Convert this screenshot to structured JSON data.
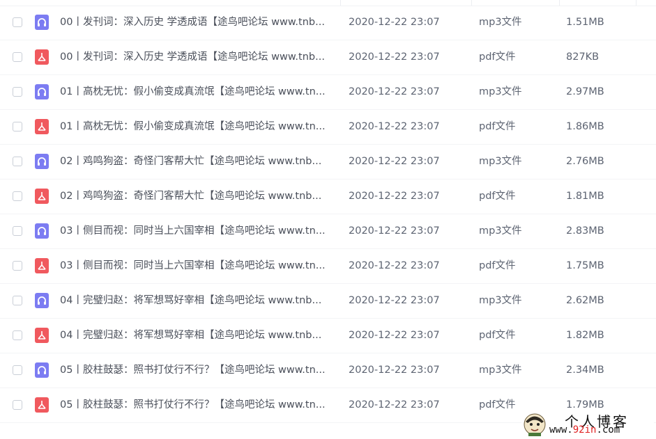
{
  "colors": {
    "mp3_icon": "#7c7cf2",
    "pdf_icon": "#f0595e",
    "text": "#4a4f5a",
    "watermark_accent": "#e02020"
  },
  "files": [
    {
      "icon": "headphones-icon",
      "kind": "mp3",
      "name": "00丨发刊词：深入历史 学透成语【途鸟吧论坛 www.tnb...",
      "date": "2020-12-22 23:07",
      "type": "mp3文件",
      "size": "1.51MB"
    },
    {
      "icon": "pdf-icon",
      "kind": "pdf",
      "name": "00丨发刊词：深入历史 学透成语【途鸟吧论坛 www.tnb...",
      "date": "2020-12-22 23:07",
      "type": "pdf文件",
      "size": "827KB"
    },
    {
      "icon": "headphones-icon",
      "kind": "mp3",
      "name": "01丨高枕无忧：假小偷变成真流氓【途鸟吧论坛 www.tn...",
      "date": "2020-12-22 23:07",
      "type": "mp3文件",
      "size": "2.97MB"
    },
    {
      "icon": "pdf-icon",
      "kind": "pdf",
      "name": "01丨高枕无忧：假小偷变成真流氓【途鸟吧论坛 www.tn...",
      "date": "2020-12-22 23:07",
      "type": "pdf文件",
      "size": "1.86MB"
    },
    {
      "icon": "headphones-icon",
      "kind": "mp3",
      "name": "02丨鸡鸣狗盗：奇怪门客帮大忙【途鸟吧论坛 www.tnb...",
      "date": "2020-12-22 23:07",
      "type": "mp3文件",
      "size": "2.76MB"
    },
    {
      "icon": "pdf-icon",
      "kind": "pdf",
      "name": "02丨鸡鸣狗盗：奇怪门客帮大忙【途鸟吧论坛 www.tnb...",
      "date": "2020-12-22 23:07",
      "type": "pdf文件",
      "size": "1.81MB"
    },
    {
      "icon": "headphones-icon",
      "kind": "mp3",
      "name": "03丨侧目而视：同时当上六国宰相【途鸟吧论坛 www.tn...",
      "date": "2020-12-22 23:07",
      "type": "mp3文件",
      "size": "2.83MB"
    },
    {
      "icon": "pdf-icon",
      "kind": "pdf",
      "name": "03丨侧目而视：同时当上六国宰相【途鸟吧论坛 www.tn...",
      "date": "2020-12-22 23:07",
      "type": "pdf文件",
      "size": "1.75MB"
    },
    {
      "icon": "headphones-icon",
      "kind": "mp3",
      "name": "04丨完璧归赵：将军想骂好宰相【途鸟吧论坛 www.tnb...",
      "date": "2020-12-22 23:07",
      "type": "mp3文件",
      "size": "2.62MB"
    },
    {
      "icon": "pdf-icon",
      "kind": "pdf",
      "name": "04丨完璧归赵：将军想骂好宰相【途鸟吧论坛 www.tnb...",
      "date": "2020-12-22 23:07",
      "type": "pdf文件",
      "size": "1.82MB"
    },
    {
      "icon": "headphones-icon",
      "kind": "mp3",
      "name": "05丨胶柱鼓瑟：照书打仗行不行？【途鸟吧论坛 www.tn...",
      "date": "2020-12-22 23:07",
      "type": "mp3文件",
      "size": "2.34MB"
    },
    {
      "icon": "pdf-icon",
      "kind": "pdf",
      "name": "05丨胶柱鼓瑟：照书打仗行不行？【途鸟吧论坛 www.tn...",
      "date": "2020-12-22 23:07",
      "type": "pdf文件",
      "size": "1.79MB"
    }
  ],
  "watermark": {
    "title": "个人博客",
    "url_prefix": "www.",
    "url_accent": "92in",
    "url_suffix": ".com"
  }
}
